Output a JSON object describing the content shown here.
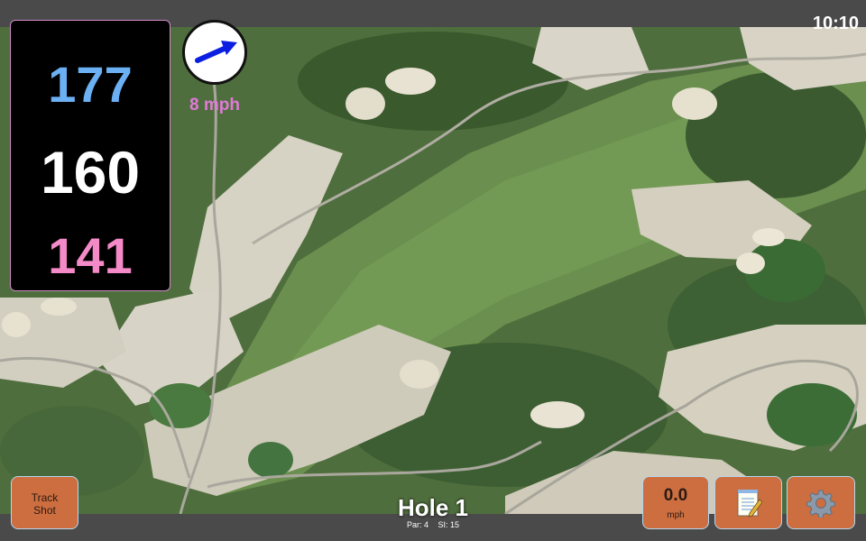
{
  "status_bar": {
    "clock": "10:10"
  },
  "distances": {
    "back": "177",
    "middle": "160",
    "front": "141"
  },
  "wind": {
    "speed_label": "8 mph",
    "arrow_icon": "wind-arrow-icon",
    "arrow_color": "#0a1fe0"
  },
  "hole": {
    "title": "Hole 1",
    "par": "Par: 4",
    "stroke_index": "SI: 15"
  },
  "buttons": {
    "track_shot": "Track\nShot",
    "wind_value": "0.0",
    "wind_unit": "mph",
    "notes_icon": "notepad-icon",
    "settings_icon": "gear-icon"
  },
  "colors": {
    "back_distance": "#6cb0f4",
    "middle_distance": "#ffffff",
    "front_distance": "#f48ac7",
    "button_bg": "#cc6e40",
    "wind_text": "#e07ad8"
  }
}
